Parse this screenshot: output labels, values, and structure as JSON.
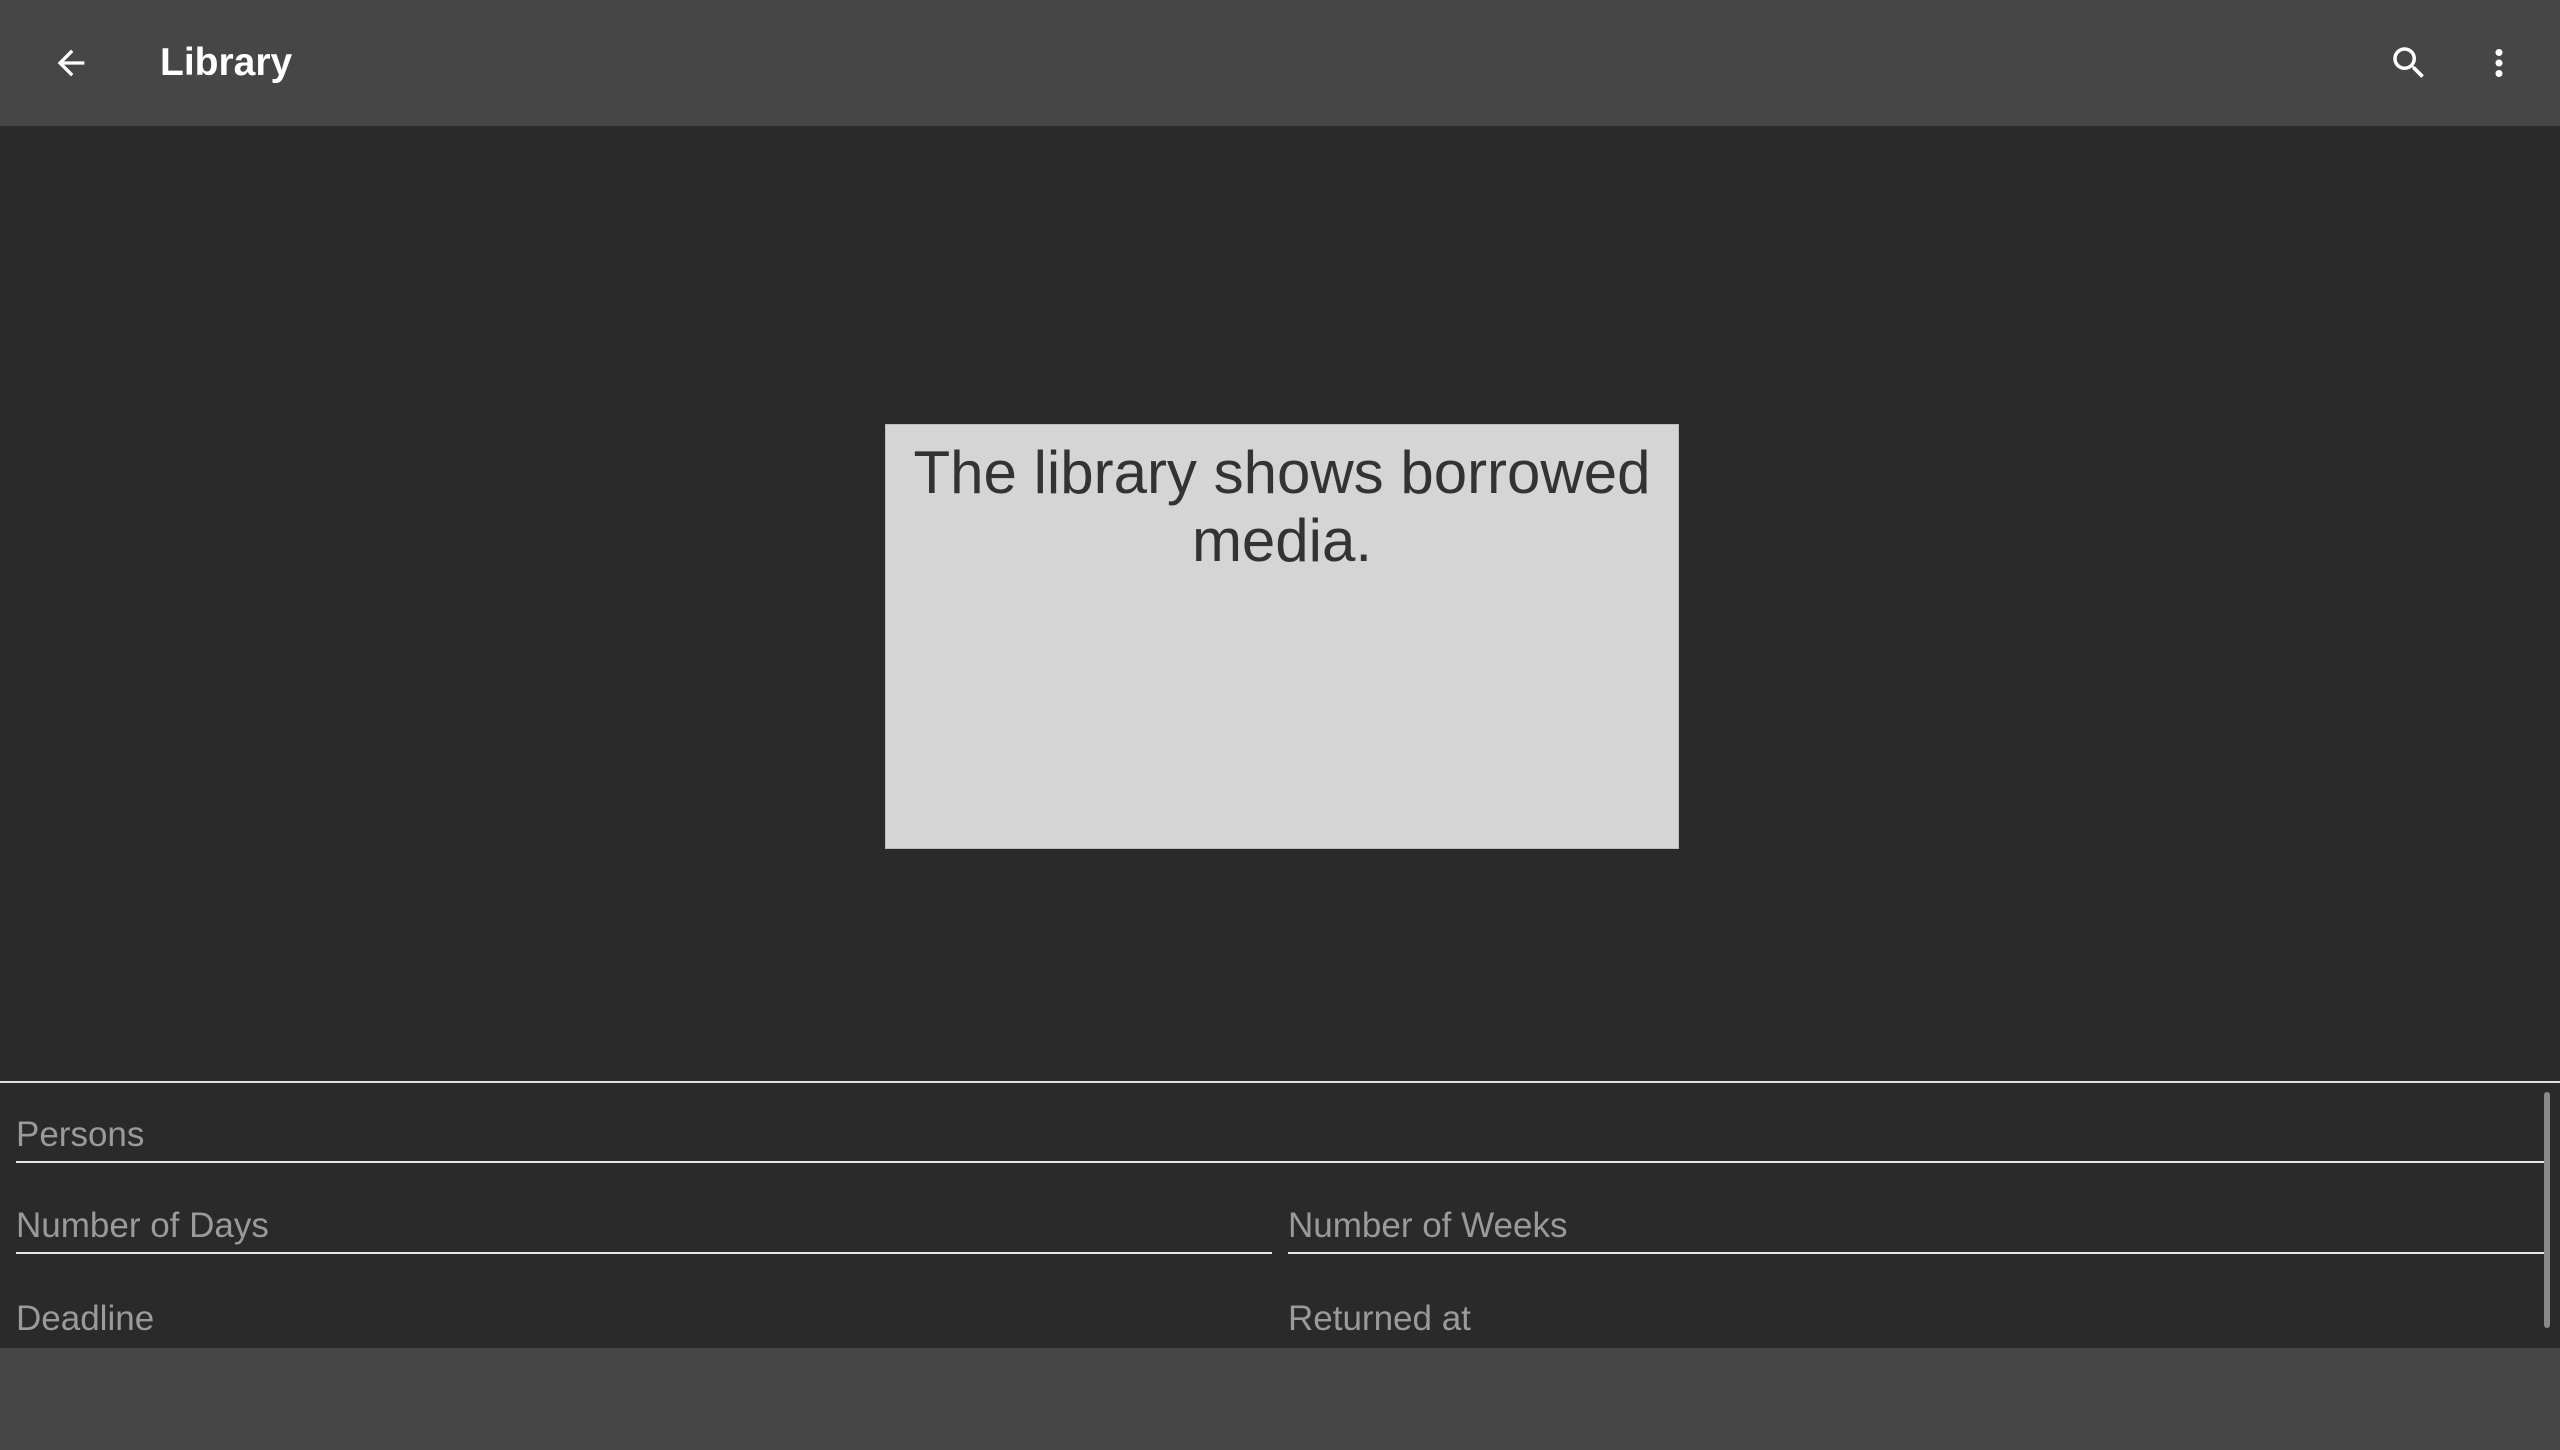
{
  "toolbar": {
    "title": "Library",
    "back_icon": "arrow-left-icon",
    "search_icon": "search-icon",
    "menu_icon": "more-vert-icon"
  },
  "content": {
    "info_text": "The library shows borrowed media."
  },
  "form": {
    "persons_label": "Persons",
    "days_label": "Number of Days",
    "weeks_label": "Number of Weeks",
    "deadline_label": "Deadline",
    "returned_label": "Returned at"
  },
  "colors": {
    "toolbar_bg": "#464646",
    "content_bg": "#2a2a2a",
    "info_box_bg": "#d5d5d5",
    "label_color": "#9a9a9a"
  }
}
